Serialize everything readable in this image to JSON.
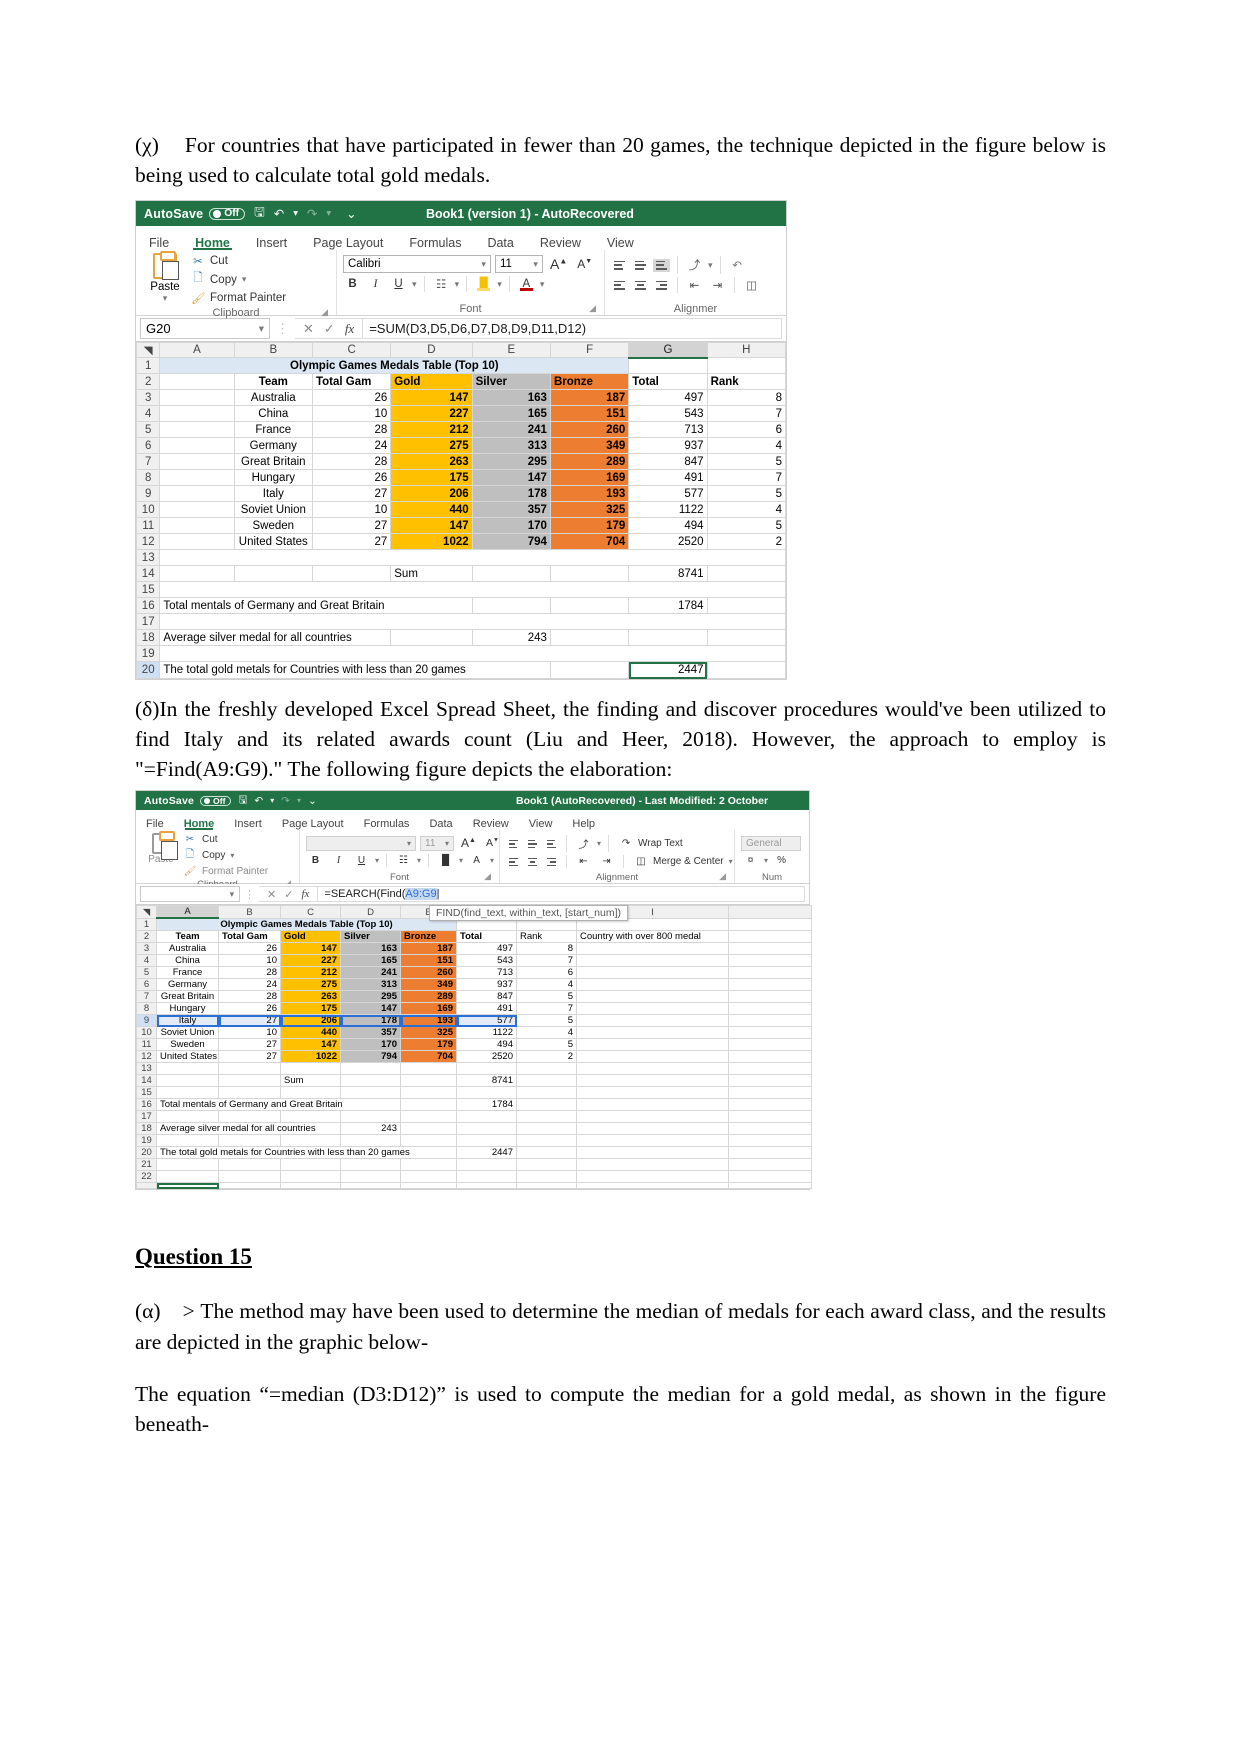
{
  "paragraphs": {
    "chi": {
      "marker": "(χ)",
      "text": "For countries that have participated in fewer than 20 games, the technique depicted in the figure below is being used to calculate total gold medals."
    },
    "delta": {
      "marker": "(δ)",
      "text": "In the freshly developed Excel Spread Sheet, the finding and discover procedures would've been utilized to find Italy and its related awards count (Liu and Heer, 2018). However, the approach to employ is \"=Find(A9:G9).\" The following figure depicts the elaboration:"
    },
    "question_title": "Question 15",
    "alpha": {
      "marker": "(α)",
      "text": "> The method may have been used to determine the median of medals for each award class, and the results are depicted in the graphic below-"
    },
    "median_note": "The equation “=median (D3:D12)” is used to compute the median for a gold medal, as shown in the figure beneath-"
  },
  "excel1": {
    "titlebar": {
      "autosave_label": "AutoSave",
      "autosave_state": "Off",
      "doc_title": "Book1 (version 1)  -  AutoRecovered",
      "save_icon": "save-icon",
      "undo_icon": "undo-icon",
      "redo_icon": "redo-icon",
      "customize_icon": "customize-qat-icon"
    },
    "tabs": [
      "File",
      "Home",
      "Insert",
      "Page Layout",
      "Formulas",
      "Data",
      "Review",
      "View"
    ],
    "active_tab": "Home",
    "clipboard": {
      "paste": "Paste",
      "cut": "Cut",
      "copy": "Copy",
      "format_painter": "Format Painter",
      "group_label": "Clipboard"
    },
    "font": {
      "family": "Calibri",
      "size": "11",
      "grow": "A",
      "shrink": "A",
      "bold": "B",
      "italic": "I",
      "underline": "U",
      "group_label": "Font"
    },
    "alignment": {
      "group_label": "Alignmer"
    },
    "formula_bar": {
      "namebox": "G20",
      "cancel_icon": "cancel-icon",
      "confirm_icon": "confirm-icon",
      "fx_icon": "insert-function-icon",
      "formula": "=SUM(D3,D5,D6,D7,D8,D9,D11,D12)"
    },
    "columns": [
      "A",
      "B",
      "C",
      "D",
      "E",
      "F",
      "G",
      "H"
    ],
    "selected_column": "G",
    "sheet": {
      "title_row": {
        "row": "1",
        "text": "Olympic Games Medals Table (Top 10)"
      },
      "headers": {
        "row": "2",
        "cells": [
          "",
          "Team",
          "Total Gam",
          "Gold",
          "Silver",
          "Bronze",
          "Total",
          "Rank"
        ]
      },
      "rows": [
        {
          "row": "3",
          "team": "Australia",
          "games": "26",
          "gold": "147",
          "silver": "163",
          "bronze": "187",
          "total": "497",
          "rank": "8"
        },
        {
          "row": "4",
          "team": "China",
          "games": "10",
          "gold": "227",
          "silver": "165",
          "bronze": "151",
          "total": "543",
          "rank": "7"
        },
        {
          "row": "5",
          "team": "France",
          "games": "28",
          "gold": "212",
          "silver": "241",
          "bronze": "260",
          "total": "713",
          "rank": "6"
        },
        {
          "row": "6",
          "team": "Germany",
          "games": "24",
          "gold": "275",
          "silver": "313",
          "bronze": "349",
          "total": "937",
          "rank": "4"
        },
        {
          "row": "7",
          "team": "Great Britain",
          "games": "28",
          "gold": "263",
          "silver": "295",
          "bronze": "289",
          "total": "847",
          "rank": "5"
        },
        {
          "row": "8",
          "team": "Hungary",
          "games": "26",
          "gold": "175",
          "silver": "147",
          "bronze": "169",
          "total": "491",
          "rank": "7"
        },
        {
          "row": "9",
          "team": "Italy",
          "games": "27",
          "gold": "206",
          "silver": "178",
          "bronze": "193",
          "total": "577",
          "rank": "5"
        },
        {
          "row": "10",
          "team": "Soviet Union",
          "games": "10",
          "gold": "440",
          "silver": "357",
          "bronze": "325",
          "total": "1122",
          "rank": "4"
        },
        {
          "row": "11",
          "team": "Sweden",
          "games": "27",
          "gold": "147",
          "silver": "170",
          "bronze": "179",
          "total": "494",
          "rank": "5"
        },
        {
          "row": "12",
          "team": "United States",
          "games": "27",
          "gold": "1022",
          "silver": "794",
          "bronze": "704",
          "total": "2520",
          "rank": "2"
        }
      ],
      "blank_13": "13",
      "sum_row": {
        "row": "14",
        "label": "Sum",
        "value": "8741"
      },
      "blank_15": "15",
      "total_two": {
        "row": "16",
        "label": "Total mentals of Germany and Great Britain",
        "value": "1784"
      },
      "blank_17": "17",
      "avg_silver": {
        "row": "18",
        "label": "Average silver medal for all countries",
        "value": "243"
      },
      "blank_19": "19",
      "gold_lt20": {
        "row": "20",
        "label": "The total gold metals for Countries with less than 20 games",
        "value": "2447"
      }
    }
  },
  "excel2": {
    "titlebar": {
      "autosave_label": "AutoSave",
      "autosave_state": "Off",
      "doc_title": "Book1 (AutoRecovered)  -  Last Modified: 2 October"
    },
    "tabs": [
      "File",
      "Home",
      "Insert",
      "Page Layout",
      "Formulas",
      "Data",
      "Review",
      "View",
      "Help"
    ],
    "active_tab": "Home",
    "clipboard": {
      "paste": "Paste",
      "cut": "Cut",
      "copy": "Copy",
      "format_painter": "Format Painter",
      "group_label": "Clipboard"
    },
    "font": {
      "family": "",
      "size": "11",
      "group_label": "Font"
    },
    "alignment": {
      "group_label": "Alignment",
      "wrap_text": "Wrap Text",
      "merge_center": "Merge & Center"
    },
    "number": {
      "group_label": "Num",
      "format": "General",
      "percent": "%"
    },
    "formula_bar": {
      "namebox": "",
      "formula_prefix": "=SEARCH(Find(",
      "formula_ref": "A9:G9",
      "tooltip": "FIND(find_text, within_text, [start_num])"
    },
    "columns": [
      "A",
      "B",
      "C",
      "D",
      "E",
      "I"
    ],
    "selected_column": "A",
    "sheet": {
      "title_row": {
        "row": "1",
        "text": "Olympic Games Medals Table (Top 10)"
      },
      "headers": {
        "row": "2",
        "cells": [
          "Team",
          "Total Gam",
          "Gold",
          "Silver",
          "Bronze",
          "Total",
          "Rank",
          "Country with over 800 medal"
        ]
      },
      "rows": [
        {
          "row": "3",
          "team": "Australia",
          "games": "26",
          "gold": "147",
          "silver": "163",
          "bronze": "187",
          "total": "497",
          "rank": "8",
          "sel": false
        },
        {
          "row": "4",
          "team": "China",
          "games": "10",
          "gold": "227",
          "silver": "165",
          "bronze": "151",
          "total": "543",
          "rank": "7",
          "sel": false
        },
        {
          "row": "5",
          "team": "France",
          "games": "28",
          "gold": "212",
          "silver": "241",
          "bronze": "260",
          "total": "713",
          "rank": "6",
          "sel": false
        },
        {
          "row": "6",
          "team": "Germany",
          "games": "24",
          "gold": "275",
          "silver": "313",
          "bronze": "349",
          "total": "937",
          "rank": "4",
          "sel": false
        },
        {
          "row": "7",
          "team": "Great Britain",
          "games": "28",
          "gold": "263",
          "silver": "295",
          "bronze": "289",
          "total": "847",
          "rank": "5",
          "sel": false
        },
        {
          "row": "8",
          "team": "Hungary",
          "games": "26",
          "gold": "175",
          "silver": "147",
          "bronze": "169",
          "total": "491",
          "rank": "7",
          "sel": false
        },
        {
          "row": "9",
          "team": "Italy",
          "games": "27",
          "gold": "206",
          "silver": "178",
          "bronze": "193",
          "total": "577",
          "rank": "5",
          "sel": true
        },
        {
          "row": "10",
          "team": "Soviet Union",
          "games": "10",
          "gold": "440",
          "silver": "357",
          "bronze": "325",
          "total": "1122",
          "rank": "4",
          "sel": false
        },
        {
          "row": "11",
          "team": "Sweden",
          "games": "27",
          "gold": "147",
          "silver": "170",
          "bronze": "179",
          "total": "494",
          "rank": "5",
          "sel": false
        },
        {
          "row": "12",
          "team": "United States",
          "games": "27",
          "gold": "1022",
          "silver": "794",
          "bronze": "704",
          "total": "2520",
          "rank": "2",
          "sel": false
        }
      ],
      "blank_13": "13",
      "sum_row": {
        "row": "14",
        "label": "Sum",
        "value": "8741"
      },
      "blank_15": "15",
      "total_two": {
        "row": "16",
        "label": "Total mentals of Germany and Great Britain",
        "value": "1784"
      },
      "blank_17": "17",
      "avg_silver": {
        "row": "18",
        "label": "Average silver medal for all countries",
        "value": "243"
      },
      "blank_19": "19",
      "gold_lt20": {
        "row": "20",
        "label": "The total gold metals for Countries with less than 20 games",
        "value": "2447"
      },
      "blank_21": "21",
      "blank_22": "22"
    }
  },
  "colors": {
    "excel_green": "#217346",
    "gold": "#ffc000",
    "silver": "#bfbfbf",
    "bronze": "#ed7d31",
    "title_band": "#dbe8f4"
  }
}
